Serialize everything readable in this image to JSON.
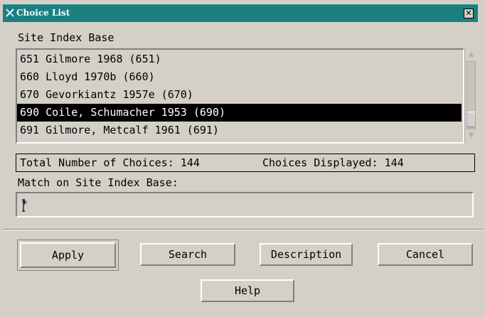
{
  "window": {
    "title": "Choice List",
    "close_glyph": "✕"
  },
  "list": {
    "heading": "Site Index Base",
    "items": [
      {
        "label": "651 Gilmore 1968 (651)",
        "selected": false
      },
      {
        "label": "660 Lloyd 1970b (660)",
        "selected": false
      },
      {
        "label": "670 Gevorkiantz 1957e (670)",
        "selected": false
      },
      {
        "label": "690 Coile, Schumacher 1953 (690)",
        "selected": true
      },
      {
        "label": "691 Gilmore, Metcalf 1961 (691)",
        "selected": false
      }
    ]
  },
  "status": {
    "total": "Total Number of Choices: 144",
    "displayed": "Choices Displayed: 144"
  },
  "match": {
    "label": "Match on Site Index Base:",
    "value": "*"
  },
  "buttons": {
    "apply": "Apply",
    "search": "Search",
    "description": "Description",
    "cancel": "Cancel",
    "help": "Help"
  },
  "colors": {
    "titlebar": "#1c7f80",
    "dialog_bg": "#d4d0c8",
    "selection_bg": "#000000",
    "selection_fg": "#ffffff"
  }
}
